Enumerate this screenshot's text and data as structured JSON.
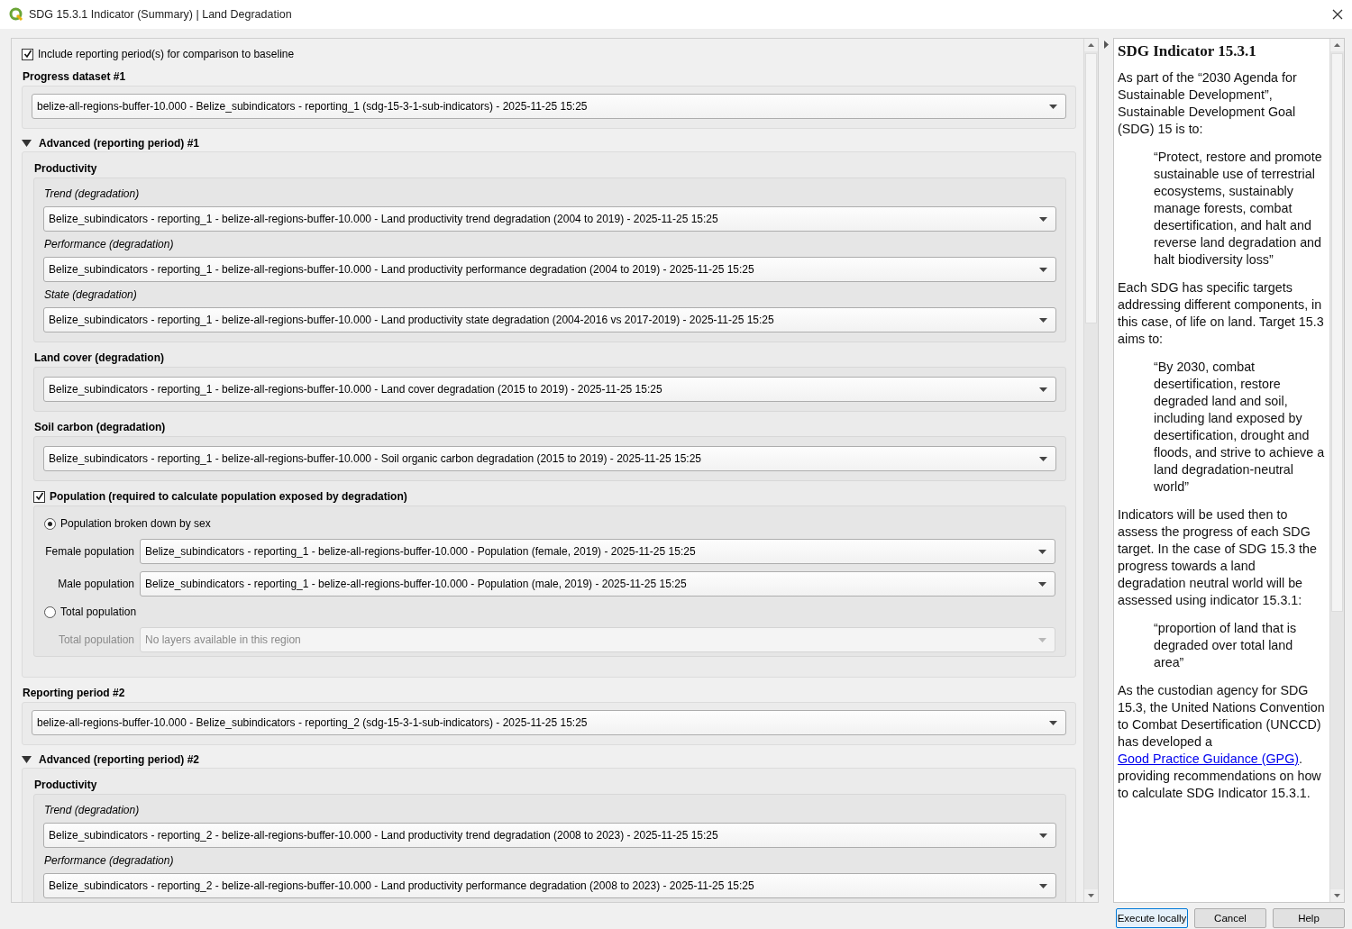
{
  "window": {
    "title": "SDG 15.3.1 Indicator (Summary) | Land Degradation"
  },
  "main": {
    "include_reporting": {
      "label": "Include reporting period(s) for comparison to baseline",
      "checked": true
    },
    "progress_dataset": {
      "title": "Progress dataset #1",
      "value": "belize-all-regions-buffer-10.000 - Belize_subindicators - reporting_1 (sdg-15-3-1-sub-indicators) - 2025-11-25 15:25"
    },
    "advanced_1": {
      "title": "Advanced (reporting period) #1",
      "expanded": true,
      "productivity": {
        "title": "Productivity",
        "fields": [
          {
            "label": "Trend (degradation)",
            "value": "Belize_subindicators - reporting_1 - belize-all-regions-buffer-10.000 - Land productivity trend degradation (2004 to 2019) - 2025-11-25 15:25"
          },
          {
            "label": "Performance (degradation)",
            "value": "Belize_subindicators - reporting_1 - belize-all-regions-buffer-10.000 - Land productivity performance degradation (2004 to 2019) - 2025-11-25 15:25"
          },
          {
            "label": "State (degradation)",
            "value": "Belize_subindicators - reporting_1 - belize-all-regions-buffer-10.000 - Land productivity state degradation (2004-2016 vs 2017-2019) - 2025-11-25 15:25"
          }
        ]
      },
      "land_cover": {
        "title": "Land cover (degradation)",
        "value": "Belize_subindicators - reporting_1 - belize-all-regions-buffer-10.000 - Land cover degradation (2015 to 2019) - 2025-11-25 15:25"
      },
      "soil_carbon": {
        "title": "Soil carbon (degradation)",
        "value": "Belize_subindicators - reporting_1 - belize-all-regions-buffer-10.000 - Soil organic carbon degradation (2015 to 2019) - 2025-11-25 15:25"
      },
      "population": {
        "label": "Population (required to calculate population exposed by degradation)",
        "checked": true,
        "options": [
          {
            "label": "Population broken down by sex",
            "selected": true,
            "fields": [
              {
                "label": "Female population",
                "value": "Belize_subindicators - reporting_1 - belize-all-regions-buffer-10.000 - Population (female, 2019) - 2025-11-25 15:25",
                "disabled": false
              },
              {
                "label": "Male population",
                "value": "Belize_subindicators - reporting_1 - belize-all-regions-buffer-10.000 - Population (male, 2019) - 2025-11-25 15:25",
                "disabled": false
              }
            ]
          },
          {
            "label": "Total population",
            "selected": false,
            "fields": [
              {
                "label": "Total population",
                "value": "No layers available in this region",
                "disabled": true
              }
            ]
          }
        ]
      }
    },
    "reporting_period_2": {
      "title": "Reporting period #2",
      "value": "belize-all-regions-buffer-10.000 - Belize_subindicators - reporting_2 (sdg-15-3-1-sub-indicators) - 2025-11-25 15:25"
    },
    "advanced_2": {
      "title": "Advanced (reporting period) #2",
      "expanded": true,
      "productivity": {
        "title": "Productivity",
        "fields": [
          {
            "label": "Trend (degradation)",
            "value": "Belize_subindicators - reporting_2 - belize-all-regions-buffer-10.000 - Land productivity trend degradation (2008 to 2023) - 2025-11-25 15:25"
          },
          {
            "label": "Performance (degradation)",
            "value": "Belize_subindicators - reporting_2 - belize-all-regions-buffer-10.000 - Land productivity performance degradation (2008 to 2023) - 2025-11-25 15:25"
          }
        ]
      }
    }
  },
  "info": {
    "title": "SDG Indicator 15.3.1",
    "paragraphs": [
      {
        "kind": "paragraph",
        "text": "As part of the “2030 Agenda for Sustainable Development”, Sustainable Development Goal (SDG) 15 is to:"
      },
      {
        "kind": "quote",
        "text": "“Protect, restore and promote sustainable use of terrestrial ecosystems, sustainably manage forests, combat desertification, and halt and reverse land degradation and halt biodiversity loss”"
      },
      {
        "kind": "paragraph",
        "text": "Each SDG has specific targets addressing different components, in this case, of life on land. Target 15.3 aims to:"
      },
      {
        "kind": "quote",
        "text": "“By 2030, combat desertification, restore degraded land and soil, including land exposed by desertification, drought and floods, and strive to achieve a land degradation-neutral world”"
      },
      {
        "kind": "paragraph",
        "text": "Indicators will be used then to assess the progress of each SDG target. In the case of SDG 15.3 the progress towards a land degradation neutral world will be assessed using indicator 15.3.1:"
      },
      {
        "kind": "quote",
        "text": "“proportion of land that is degraded over total land area”"
      },
      {
        "kind": "paragraph",
        "text": "As the custodian agency for SDG 15.3, the United Nations Convention to Combat Desertification (UNCCD) has developed a ",
        "link": "Good Practice Guidance (GPG)",
        "after": ". providing recommendations on how to calculate SDG Indicator 15.3.1."
      }
    ]
  },
  "buttons": [
    {
      "label": "Execute locally",
      "focused": true
    },
    {
      "label": "Cancel",
      "focused": false
    },
    {
      "label": "Help",
      "focused": false
    }
  ]
}
